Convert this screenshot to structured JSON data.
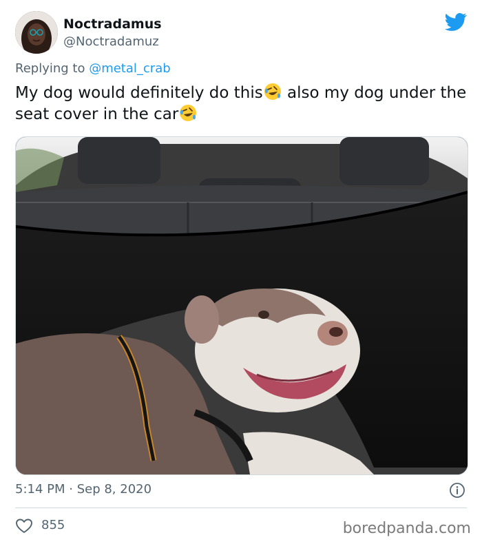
{
  "author": {
    "display_name": "Noctradamus",
    "handle": "@Noctradamuz",
    "avatar": "avatar-photo"
  },
  "reply": {
    "prefix": "Replying to ",
    "mention": "@metal_crab"
  },
  "tweet": {
    "text_part1": "My dog would definitely do this",
    "emoji": "rolling-on-floor-laughing-emoji",
    "text_part2": " also my dog under the seat cover in the car",
    "timestamp": "5:14 PM · Sep 8, 2020"
  },
  "media": {
    "photo": "dog-under-seat-cover-photo"
  },
  "engagement": {
    "likes": "855"
  },
  "watermark": "boredpanda.com",
  "colors": {
    "brand": "#1d9bf0",
    "text": "#0f1419",
    "secondary": "#536471",
    "border": "#cfd9de"
  },
  "icons": [
    "twitter-bird-icon",
    "info-icon",
    "heart-icon"
  ]
}
